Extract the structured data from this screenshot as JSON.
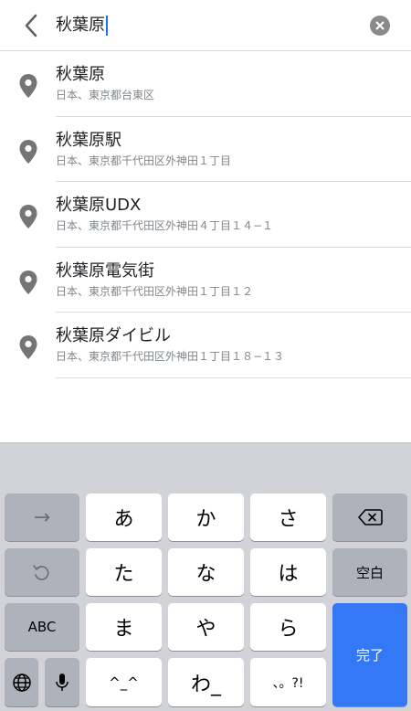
{
  "search": {
    "query": "秋葉原",
    "back_icon": "chevron-left-icon",
    "clear_icon": "clear-x-circle-icon"
  },
  "results": [
    {
      "title": "秋葉原",
      "address": "日本、東京都台東区"
    },
    {
      "title": "秋葉原駅",
      "address": "日本、東京都千代田区外神田１丁目"
    },
    {
      "title": "秋葉原UDX",
      "address": "日本、東京都千代田区外神田４丁目１４−１"
    },
    {
      "title": "秋葉原電気街",
      "address": "日本、東京都千代田区外神田１丁目１２"
    },
    {
      "title": "秋葉原ダイビル",
      "address": "日本、東京都千代田区外神田１丁目１８−１３"
    }
  ],
  "keyboard": {
    "row1": {
      "next": "→",
      "a": "あ",
      "ka": "か",
      "sa": "さ"
    },
    "row2": {
      "ta": "た",
      "na": "な",
      "ha": "は",
      "space": "空白"
    },
    "row3": {
      "abc": "ABC",
      "ma": "ま",
      "ya": "や",
      "ra": "ら",
      "done": "完了"
    },
    "row4": {
      "kaomoji": "^_^",
      "wa": "わ_",
      "punct": "、。?!"
    }
  },
  "colors": {
    "accent": "#3478f6",
    "caret": "#1a73e8",
    "pin": "#757575"
  }
}
